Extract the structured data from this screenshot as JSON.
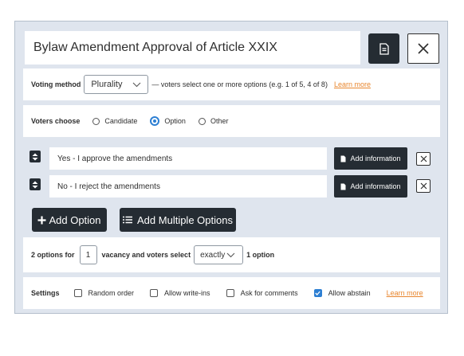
{
  "title": "Bylaw Amendment Approval of Article XXIX",
  "icons": {
    "document": "document-icon",
    "close": "close-icon",
    "sort": "sort-arrows-icon",
    "plus": "plus-icon",
    "list": "list-icon",
    "check": "checkmark-icon"
  },
  "voting": {
    "label": "Voting method",
    "selected": "Plurality",
    "description": "— voters select one or more options (e.g. 1 of 5, 4 of 8)",
    "learn_more": "Learn more"
  },
  "voters_choose": {
    "label": "Voters choose",
    "options": [
      "Candidate",
      "Option",
      "Other"
    ],
    "selected": "Option"
  },
  "options": [
    {
      "text": "Yes - I approve the amendments",
      "add_info": "Add information"
    },
    {
      "text": "No - I reject the amendments",
      "add_info": "Add information"
    }
  ],
  "buttons": {
    "add_option": "Add Option",
    "add_multiple": "Add Multiple Options"
  },
  "counts": {
    "prefix": "2 options for",
    "vacancies": "1",
    "middle": "vacancy and voters select",
    "mode": "exactly",
    "suffix": "1 option"
  },
  "settings": {
    "label": "Settings",
    "random_order": {
      "label": "Random order",
      "checked": false
    },
    "write_ins": {
      "label": "Allow write-ins",
      "checked": false
    },
    "comments": {
      "label": "Ask for comments",
      "checked": false
    },
    "abstain": {
      "label": "Allow abstain",
      "checked": true
    },
    "learn_more": "Learn more"
  },
  "colors": {
    "accent": "#2d7fd3",
    "dark_button": "#252c33",
    "link": "#e8862e",
    "panel": "#dfe5ee"
  }
}
